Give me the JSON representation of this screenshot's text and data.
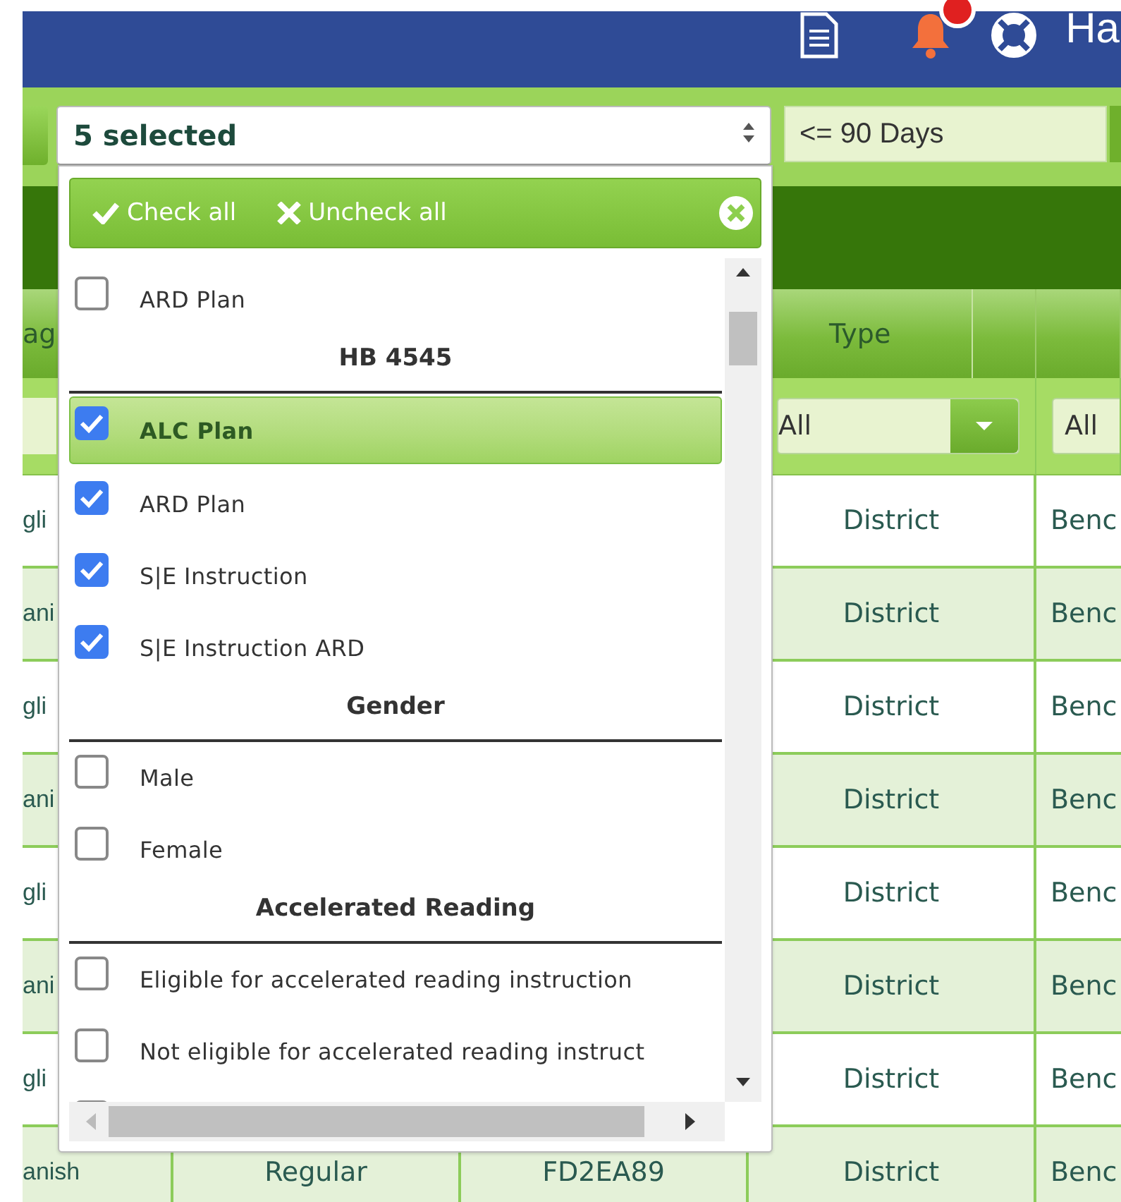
{
  "header": {
    "user": "Ha",
    "notifications": true
  },
  "filters": {
    "multiselect": {
      "value": "5 selected",
      "open": true
    },
    "range": {
      "value": "<= 90 Days"
    }
  },
  "dropdown": {
    "check_all": "Check all",
    "uncheck_all": "Uncheck all",
    "options": [
      {
        "kind": "option",
        "label": "ARD Plan",
        "checked": false,
        "highlighted": false
      },
      {
        "kind": "header",
        "label": "HB 4545"
      },
      {
        "kind": "option",
        "label": "ALC Plan",
        "checked": true,
        "highlighted": true
      },
      {
        "kind": "option",
        "label": "ARD Plan",
        "checked": true,
        "highlighted": false
      },
      {
        "kind": "option",
        "label": "S|E Instruction",
        "checked": true,
        "highlighted": false
      },
      {
        "kind": "option",
        "label": "S|E Instruction ARD",
        "checked": true,
        "highlighted": false
      },
      {
        "kind": "header",
        "label": "Gender"
      },
      {
        "kind": "option",
        "label": "Male",
        "checked": false,
        "highlighted": false
      },
      {
        "kind": "option",
        "label": "Female",
        "checked": false,
        "highlighted": false
      },
      {
        "kind": "header",
        "label": "Accelerated Reading"
      },
      {
        "kind": "option",
        "label": "Eligible for accelerated reading instruction",
        "checked": false,
        "highlighted": false
      },
      {
        "kind": "option",
        "label": "Not eligible for accelerated reading instruct",
        "checked": false,
        "highlighted": false
      },
      {
        "kind": "option",
        "checked": false,
        "highlighted": false
      }
    ]
  },
  "table": {
    "columns": {
      "column_1": "ag",
      "type": "Type"
    },
    "filters": {
      "type": "All",
      "column_5": "All"
    },
    "rows": [
      {
        "column_1": "gli",
        "type": "District",
        "column_5": "Benc"
      },
      {
        "column_1": "ani",
        "type": "District",
        "column_5": "Benc"
      },
      {
        "column_1": "gli",
        "type": "District",
        "column_5": "Benc"
      },
      {
        "column_1": "ani",
        "type": "District",
        "column_5": "Benc"
      },
      {
        "column_1": "gli",
        "type": "District",
        "column_5": "Benc"
      },
      {
        "column_1": "ani",
        "type": "District",
        "column_5": "Benc"
      },
      {
        "column_1": "gli",
        "type": "District",
        "column_5": "Benc"
      },
      {
        "column_1": "anish",
        "column_2": "Regular",
        "column_3": "FD2EA89",
        "type": "District",
        "column_5": "Benc"
      }
    ]
  }
}
